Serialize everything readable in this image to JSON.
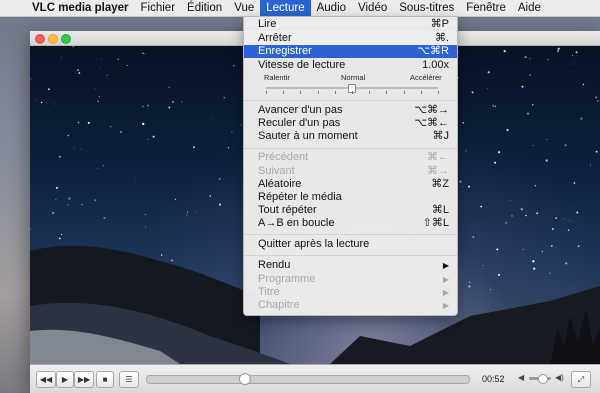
{
  "menubar": {
    "apple_icon": "",
    "app_name": "VLC media player",
    "items": [
      "Fichier",
      "Édition",
      "Vue",
      "Lecture",
      "Audio",
      "Vidéo",
      "Sous-titres",
      "Fenêtre",
      "Aide"
    ]
  },
  "menu": {
    "items": [
      {
        "label": "Lire",
        "shortcut": "⌘P"
      },
      {
        "label": "Arrêter",
        "shortcut": "⌘."
      },
      {
        "label": "Enregistrer",
        "shortcut": "⌥⌘R"
      },
      {
        "label": "Vitesse de lecture",
        "shortcut": "1.00x"
      },
      {
        "label": "Avancer d'un pas",
        "shortcut": "⌥⌘→"
      },
      {
        "label": "Reculer d'un pas",
        "shortcut": "⌥⌘←"
      },
      {
        "label": "Sauter à un moment",
        "shortcut": "⌘J"
      },
      {
        "label": "Précédent",
        "shortcut": "⌘←"
      },
      {
        "label": "Suivant",
        "shortcut": "⌘→"
      },
      {
        "label": "Aléatoire",
        "shortcut": "⌘Z"
      },
      {
        "label": "Répéter le média",
        "shortcut": ""
      },
      {
        "label": "Tout répéter",
        "shortcut": "⌘L"
      },
      {
        "label": "A→B en boucle",
        "shortcut": "⇧⌘L"
      },
      {
        "label": "Quitter après la lecture",
        "shortcut": ""
      },
      {
        "label": "Rendu",
        "shortcut": "▶"
      },
      {
        "label": "Programme",
        "shortcut": "▶"
      },
      {
        "label": "Titre",
        "shortcut": "▶"
      },
      {
        "label": "Chapitre",
        "shortcut": "▶"
      }
    ],
    "speed": {
      "slow": "Ralentir",
      "normal": "Normal",
      "fast": "Accélérer",
      "value_fraction": 0.5
    }
  },
  "player": {
    "time": "00:52",
    "progress_fraction": 0.3,
    "volume_fraction": 0.6,
    "buttons": {
      "rewind": "◀◀",
      "play": "▶",
      "forward": "▶▶",
      "stop": "■",
      "playlist": "☰",
      "fullscreen": "⤢"
    }
  },
  "colors": {
    "highlight": "#2b64d2"
  }
}
